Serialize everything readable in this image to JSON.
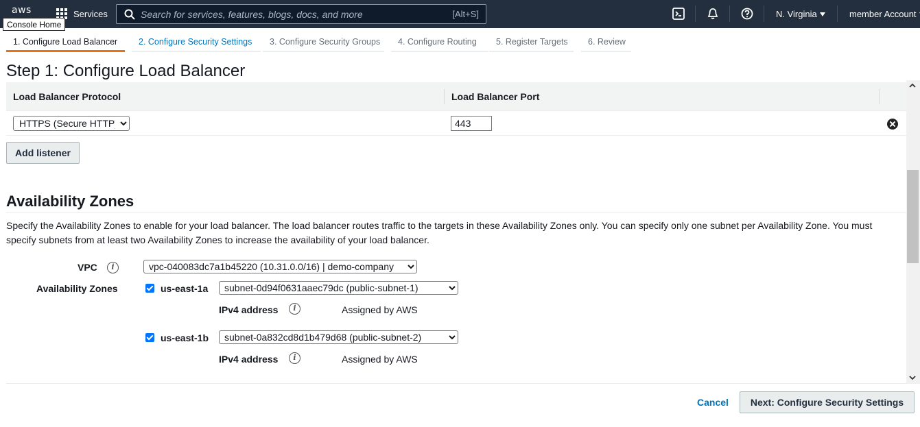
{
  "topnav": {
    "logo_text": "aws",
    "tooltip": "Console Home",
    "services_label": "Services",
    "search_placeholder": "Search for services, features, blogs, docs, and more",
    "search_shortcut": "[Alt+S]",
    "region_label": "N. Virginia",
    "account_label": "member Account",
    "icons": [
      "grid-icon",
      "search-icon",
      "cloudshell-icon",
      "bell-icon",
      "help-icon"
    ]
  },
  "tabs": [
    {
      "label": "1. Configure Load Balancer",
      "state": "active"
    },
    {
      "label": "2. Configure Security Settings",
      "state": "link"
    },
    {
      "label": "3. Configure Security Groups",
      "state": "disabled"
    },
    {
      "label": "4. Configure Routing",
      "state": "disabled"
    },
    {
      "label": "5. Register Targets",
      "state": "disabled"
    },
    {
      "label": "6. Review",
      "state": "disabled"
    }
  ],
  "step_title": "Step 1: Configure Load Balancer",
  "listeners": {
    "col_protocol": "Load Balancer Protocol",
    "col_port": "Load Balancer Port",
    "rows": [
      {
        "protocol": "HTTPS (Secure HTTP)",
        "port": "443"
      }
    ],
    "add_label": "Add listener"
  },
  "availability": {
    "title": "Availability Zones",
    "description": "Specify the Availability Zones to enable for your load balancer. The load balancer routes traffic to the targets in these Availability Zones only. You can specify only one subnet per Availability Zone. You must specify subnets from at least two Availability Zones to increase the availability of your load balancer.",
    "vpc_label": "VPC",
    "vpc_value": "vpc-040083dc7a1b45220 (10.31.0.0/16) | demo-company",
    "zones_label": "Availability Zones",
    "info_glyph": "i",
    "zones": [
      {
        "name": "us-east-1a",
        "checked": true,
        "subnet": "subnet-0d94f0631aaec79dc (public-subnet-1)",
        "ipv4_label": "IPv4 address",
        "ipv4_value": "Assigned by AWS"
      },
      {
        "name": "us-east-1b",
        "checked": true,
        "subnet": "subnet-0a832cd8d1b479d68 (public-subnet-2)",
        "ipv4_label": "IPv4 address",
        "ipv4_value": "Assigned by AWS"
      }
    ]
  },
  "footer": {
    "cancel_label": "Cancel",
    "next_label": "Next: Configure Security Settings"
  },
  "colors": {
    "nav_bg": "#232f3e",
    "accent_orange": "#ec7211",
    "link_blue": "#0073bb",
    "checkbox_blue": "#0075ff"
  }
}
